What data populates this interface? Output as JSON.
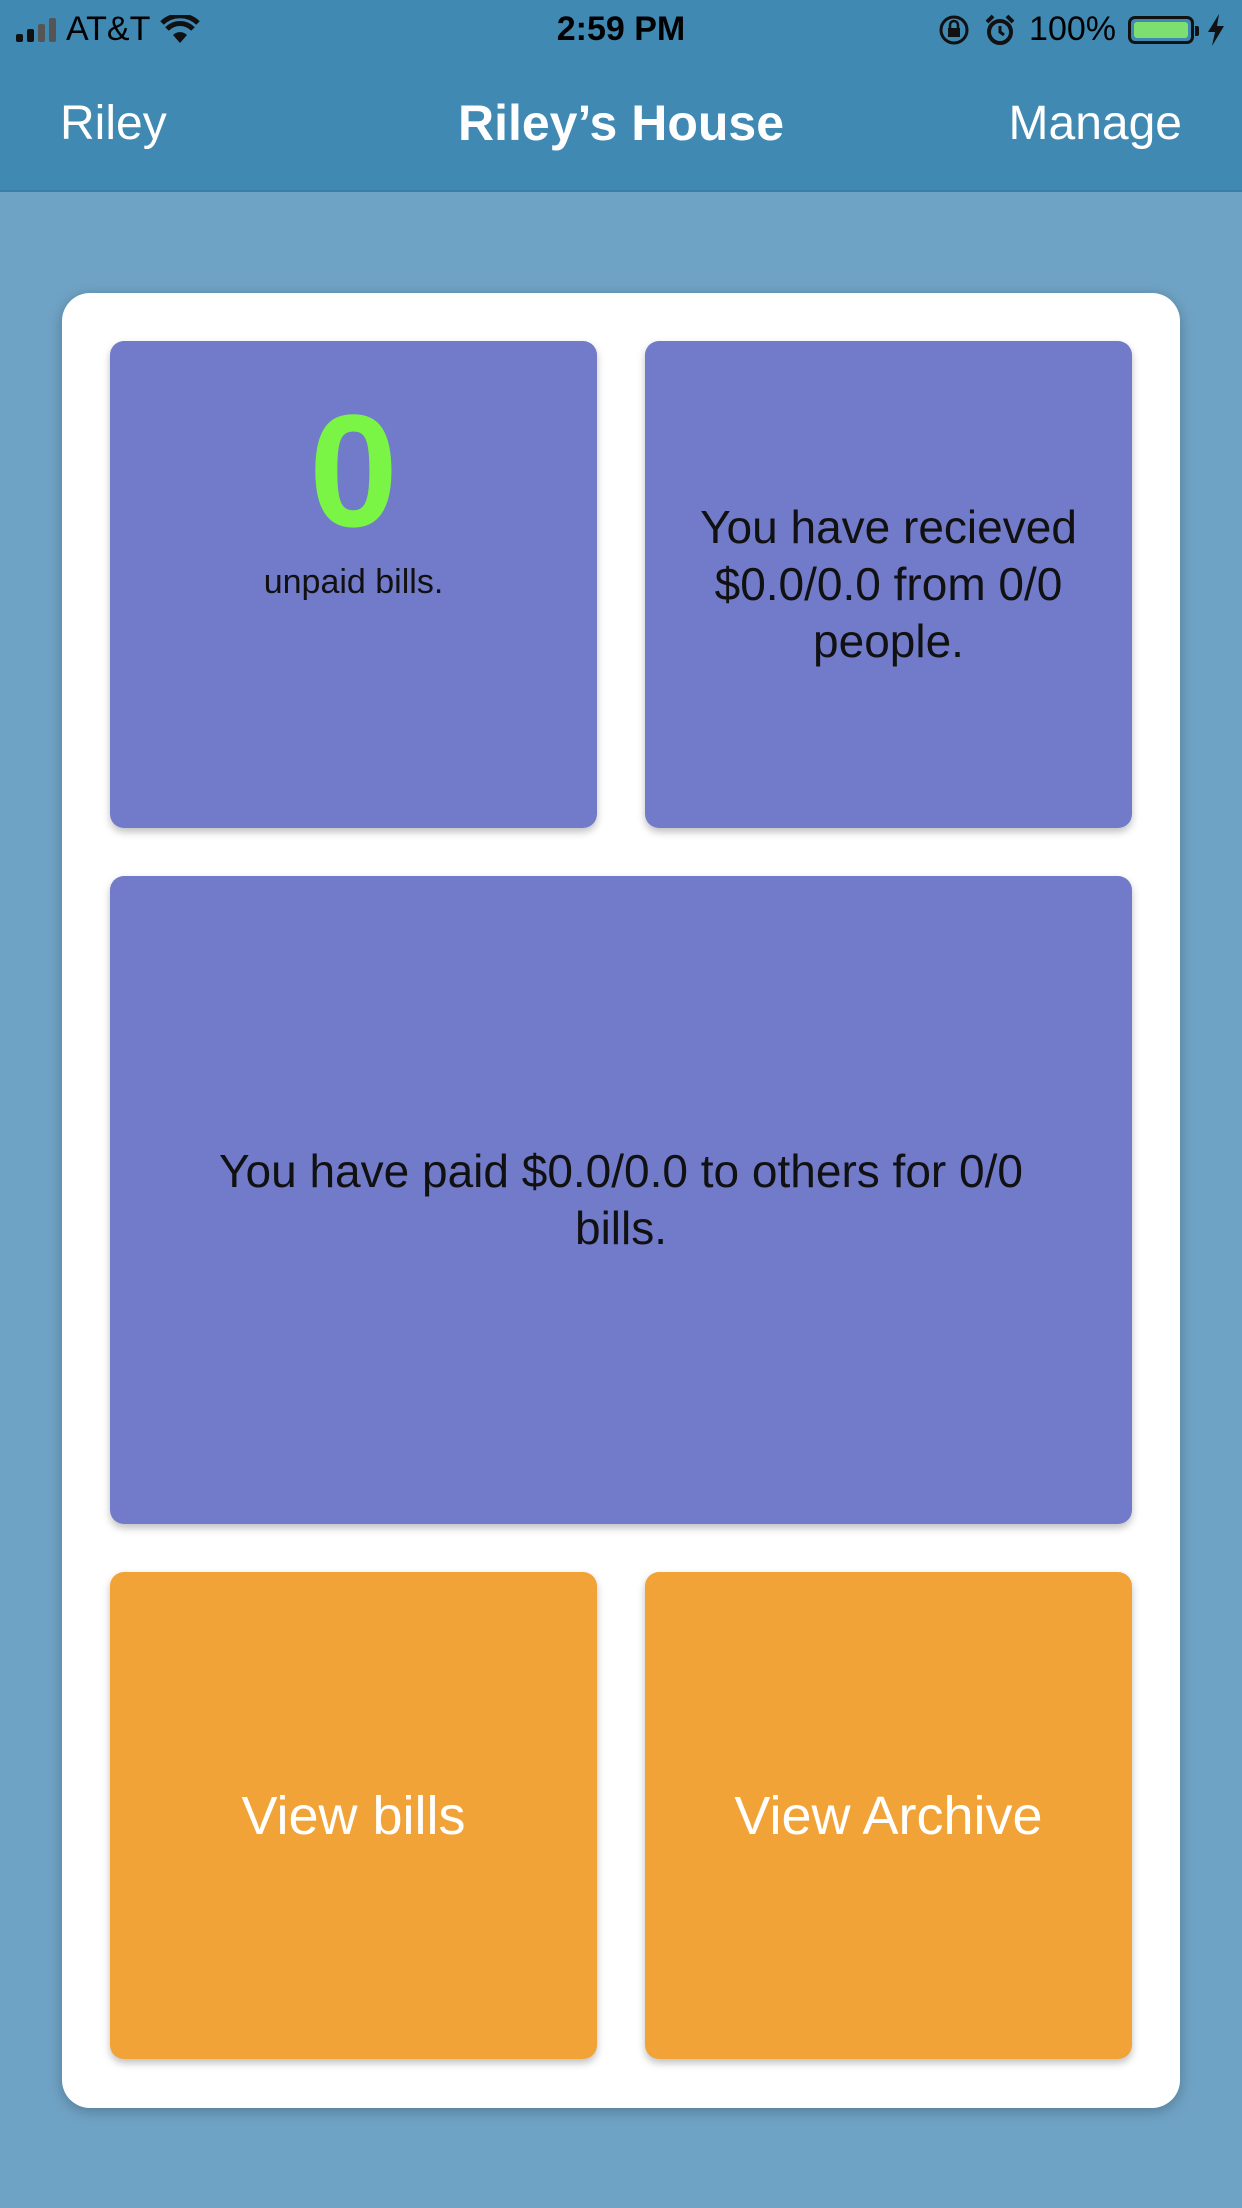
{
  "status_bar": {
    "carrier": "AT&T",
    "time": "2:59 PM",
    "battery": "100%"
  },
  "nav": {
    "left": "Riley",
    "title": "Riley’s House",
    "right": "Manage"
  },
  "tiles": {
    "unpaid_count": "0",
    "unpaid_label": "unpaid bills.",
    "received": "You have recieved $0.0/0.0 from 0/0 people.",
    "paid": "You have paid $0.0/0.0 to others for 0/0 bills.",
    "view_bills": "View bills",
    "view_archive": "View Archive"
  },
  "colors": {
    "nav_bg": "#3f89b3",
    "page_bg": "#6fa3c5",
    "tile_purple": "#717bc9",
    "tile_orange": "#f2a337",
    "count_green": "#7bf545"
  }
}
